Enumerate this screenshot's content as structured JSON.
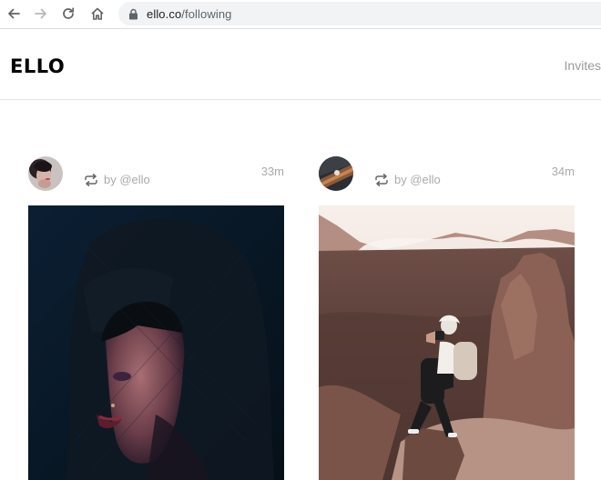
{
  "browser": {
    "url_domain": "ello.co",
    "url_path": "/following",
    "icons": [
      "back-arrow-icon",
      "forward-arrow-icon",
      "reload-icon",
      "home-icon",
      "lock-icon"
    ]
  },
  "header": {
    "logo": "ELLO",
    "invites_label": "Invites"
  },
  "posts": [
    {
      "byline": "by @ello",
      "time": "33m",
      "icon": "repost-icon"
    },
    {
      "byline": "by @ello",
      "time": "34m",
      "icon": "repost-icon"
    }
  ]
}
